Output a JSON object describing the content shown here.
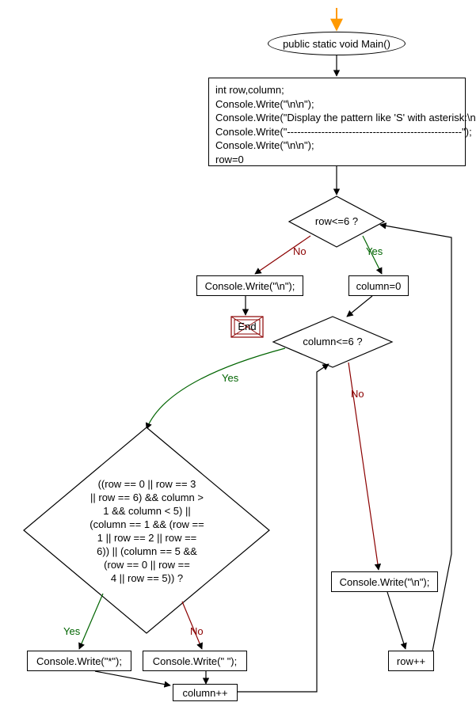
{
  "chart_data": {
    "type": "flowchart",
    "title": "",
    "nodes": [
      {
        "id": "start",
        "type": "ellipse",
        "label": "public static void Main()"
      },
      {
        "id": "init",
        "type": "process",
        "label": "int row,column;\nConsole.Write(\"\\n\\n\");\nConsole.Write(\"Display the pattern like 'S' with asterisk:\\n\");\nConsole.Write(\"---------------------------------------------------\");\nConsole.Write(\"\\n\\n\");\nrow=0"
      },
      {
        "id": "cond_row",
        "type": "decision",
        "label": "row<=6 ?"
      },
      {
        "id": "write_nl1",
        "type": "process",
        "label": "Console.Write(\"\\n\");"
      },
      {
        "id": "end",
        "type": "terminator",
        "label": "End"
      },
      {
        "id": "set_col",
        "type": "process",
        "label": "column=0"
      },
      {
        "id": "cond_col",
        "type": "decision",
        "label": "column<=6 ?"
      },
      {
        "id": "cond_big",
        "type": "decision",
        "label": "((row == 0 || row == 3\n|| row == 6) && column >\n1 && column < 5) ||\n(column == 1 && (row ==\n1 || row == 2 || row ==\n6)) || (column == 5 &&\n(row == 0 || row ==\n4 || row == 5)) ?"
      },
      {
        "id": "write_nl2",
        "type": "process",
        "label": "Console.Write(\"\\n\");"
      },
      {
        "id": "write_star",
        "type": "process",
        "label": "Console.Write(\"*\");"
      },
      {
        "id": "write_space",
        "type": "process",
        "label": "Console.Write(\" \");"
      },
      {
        "id": "col_inc",
        "type": "process",
        "label": "column++"
      },
      {
        "id": "row_inc",
        "type": "process",
        "label": "row++"
      }
    ],
    "edges": [
      {
        "from": "entry",
        "to": "start",
        "label": ""
      },
      {
        "from": "start",
        "to": "init",
        "label": ""
      },
      {
        "from": "init",
        "to": "cond_row",
        "label": ""
      },
      {
        "from": "cond_row",
        "to": "write_nl1",
        "label": "No"
      },
      {
        "from": "cond_row",
        "to": "set_col",
        "label": "Yes"
      },
      {
        "from": "write_nl1",
        "to": "end",
        "label": ""
      },
      {
        "from": "set_col",
        "to": "cond_col",
        "label": ""
      },
      {
        "from": "cond_col",
        "to": "cond_big",
        "label": "Yes"
      },
      {
        "from": "cond_col",
        "to": "write_nl2",
        "label": "No"
      },
      {
        "from": "cond_big",
        "to": "write_star",
        "label": "Yes"
      },
      {
        "from": "cond_big",
        "to": "write_space",
        "label": "No"
      },
      {
        "from": "write_star",
        "to": "col_inc",
        "label": ""
      },
      {
        "from": "write_space",
        "to": "col_inc",
        "label": ""
      },
      {
        "from": "col_inc",
        "to": "cond_col",
        "label": ""
      },
      {
        "from": "write_nl2",
        "to": "row_inc",
        "label": ""
      },
      {
        "from": "row_inc",
        "to": "cond_row",
        "label": ""
      }
    ]
  },
  "labels": {
    "yes": "Yes",
    "no": "No"
  }
}
